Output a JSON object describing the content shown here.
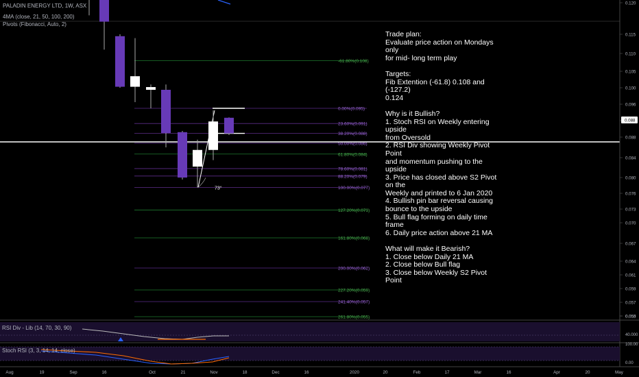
{
  "legend": {
    "title": "PALADIN ENERGY LTD, 1W, ASX",
    "ma": "4MA (close, 21, 50, 100, 200)",
    "pivots": "Pivots (Fibonacci, Auto, 2)"
  },
  "notes": "Trade plan:\nEvaluate price action on Mondays only\nfor mid- long term play\n\nTargets:\nFib Extention (-61.8) 0.108 and (-127.2)\n0.124\n\nWhy is it Bullish?\n1. Stoch RSI on Weekly entering upside\nfrom Oversold\n2. RSI Div showing Weekly Pivot Point\nand momentum pushing to the upside\n3. Price has closed above S2 Pivot on the\nWeekly and printed to 6 Jan 2020\n4. Bullish pin bar reversal causing\nbounce to the upside\n5. Bull flag forming on daily time frame\n6. Daily price action above 21 MA\n\nWhat will make it Bearish?\n1. Close below Daily 21 MA\n2. Close below Bull flag\n3. Close below Weekly S2 Pivot Point",
  "panes": {
    "rsi_label": "RSI Div - Lib (14, 70, 30, 90)",
    "stoch_label": "Stoch RSI (3, 3, 14, 14, close)",
    "rsi_tick": "40.000",
    "stoch_tick": "100.00",
    "stoch_tick2": "0.00"
  },
  "angle_label": "73°",
  "chart_data": {
    "type": "candlestick",
    "price_axis": {
      "ticks": [
        "0.120",
        "0.115",
        "0.110",
        "0.105",
        "0.100",
        "0.096",
        "0.092",
        "0.088",
        "0.084",
        "0.080",
        "0.076",
        "0.073",
        "0.070",
        "0.067",
        "0.064",
        "0.061",
        "0.059",
        "0.057",
        "0.055",
        "0.053"
      ],
      "current": "0.088"
    },
    "time_axis": [
      "Aug",
      "19",
      "Sep",
      "16",
      "Oct",
      "21",
      "Nov",
      "18",
      "Dec",
      "16",
      "2020",
      "20",
      "Feb",
      "17",
      "Mar",
      "16",
      "Apr",
      "20",
      "May"
    ],
    "candles": [
      {
        "o": 0.1245,
        "h": 0.127,
        "l": 0.118,
        "c": 0.1205,
        "color": "up"
      },
      {
        "o": 0.1205,
        "h": 0.123,
        "l": 0.111,
        "c": 0.117,
        "color": "down"
      },
      {
        "o": 0.1145,
        "h": 0.115,
        "l": 0.1,
        "c": 0.1003,
        "color": "down"
      },
      {
        "o": 0.1003,
        "h": 0.114,
        "l": 0.0965,
        "c": 0.1035,
        "color": "up"
      },
      {
        "o": 0.1002,
        "h": 0.101,
        "l": 0.095,
        "c": 0.0995,
        "color": "up"
      },
      {
        "o": 0.0995,
        "h": 0.101,
        "l": 0.086,
        "c": 0.089,
        "color": "down"
      },
      {
        "o": 0.0892,
        "h": 0.0895,
        "l": 0.0795,
        "c": 0.08,
        "color": "down"
      },
      {
        "o": 0.0822,
        "h": 0.0875,
        "l": 0.0775,
        "c": 0.0855,
        "color": "up"
      },
      {
        "o": 0.0855,
        "h": 0.0945,
        "l": 0.0835,
        "c": 0.0918,
        "color": "up"
      },
      {
        "o": 0.0927,
        "h": 0.0928,
        "l": 0.0885,
        "c": 0.0889,
        "color": "down"
      }
    ],
    "fib_levels": [
      {
        "label": "-61.80%(0.108)",
        "price": 0.108,
        "color": "green"
      },
      {
        "label": "0.00%(0.095)",
        "price": 0.095,
        "color": "purple"
      },
      {
        "label": "23.60%(0.091)",
        "price": 0.0913,
        "color": "purple"
      },
      {
        "label": "38.20%(0.088)",
        "price": 0.0889,
        "color": "purple"
      },
      {
        "label": "50.00%(0.086)",
        "price": 0.0868,
        "color": "purple"
      },
      {
        "label": "61.80%(0.084)",
        "price": 0.0847,
        "color": "green"
      },
      {
        "label": "78.60%(0.081)",
        "price": 0.0818,
        "color": "purple"
      },
      {
        "label": "88.20%(0.079)",
        "price": 0.0803,
        "color": "purple"
      },
      {
        "label": "100.00%(0.077)",
        "price": 0.0775,
        "color": "purple"
      },
      {
        "label": "127.20%(0.073)",
        "price": 0.0728,
        "color": "green"
      },
      {
        "label": "161.80%(0.068)",
        "price": 0.0678,
        "color": "green"
      },
      {
        "label": "200.00%(0.062)",
        "price": 0.0625,
        "color": "purple"
      },
      {
        "label": "227.20%(0.059)",
        "price": 0.0588,
        "color": "green"
      },
      {
        "label": "241.40%(0.057)",
        "price": 0.0571,
        "color": "purple"
      },
      {
        "label": "261.80%(0.055)",
        "price": 0.0549,
        "color": "green"
      },
      {
        "label": "278.60%(0.053)",
        "price": 0.0527,
        "color": "purple"
      }
    ],
    "horizontal_line": 0.0872,
    "flag_lines": [
      0.095,
      0.0889
    ]
  }
}
